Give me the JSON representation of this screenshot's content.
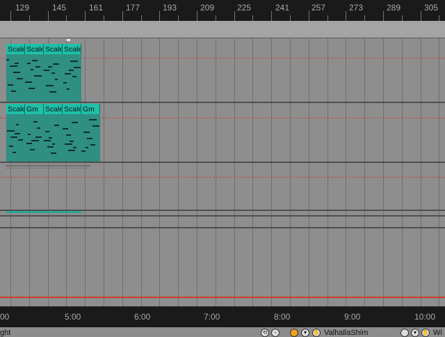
{
  "ruler": {
    "bar_numbers": [
      "129",
      "145",
      "161",
      "177",
      "193",
      "209",
      "225",
      "241",
      "257",
      "273",
      "289",
      "305"
    ]
  },
  "tracks": [
    {
      "clips": [
        {
          "label": "Scale"
        },
        {
          "label": "Scale"
        },
        {
          "label": "Scale"
        },
        {
          "label": "Scale"
        }
      ]
    },
    {
      "clips": [
        {
          "label": "Scale"
        },
        {
          "label": "Gm"
        },
        {
          "label": "Scale"
        },
        {
          "label": "Scale"
        },
        {
          "label": "Gm"
        }
      ]
    }
  ],
  "time_ruler": {
    "labels": [
      "00",
      "5:00",
      "6:00",
      "7:00",
      "8:00",
      "9:00",
      "10:00"
    ]
  },
  "status_bar": {
    "left_text": "ght",
    "device_name": "ValhallaShim",
    "right_text": "Wi"
  },
  "colors": {
    "clip_body": "#2e8f82",
    "clip_header": "#1fbfa8",
    "ruler_bg": "#1a1a1a",
    "lane_bg": "#8e8e8e",
    "loop_line": "#c24a4a"
  }
}
